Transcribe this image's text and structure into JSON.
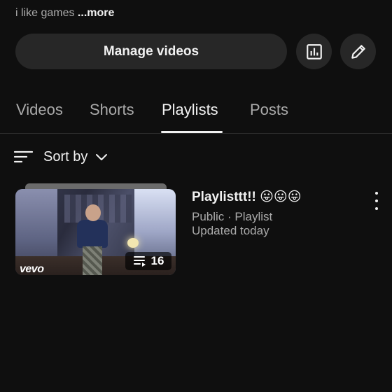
{
  "bio": {
    "text": "i like games ",
    "more": "...more"
  },
  "actions": {
    "manage_videos": "Manage videos",
    "analytics_icon": "bar-chart-icon",
    "edit_icon": "pencil-icon"
  },
  "tabs": [
    {
      "label": "Videos"
    },
    {
      "label": "Shorts"
    },
    {
      "label": "Playlists",
      "active": true
    },
    {
      "label": "Posts"
    }
  ],
  "sort": {
    "label": "Sort by",
    "icon": "sort-lines-icon"
  },
  "playlist": {
    "title": "Playlisttt!! 😛😛😛",
    "meta": "Public · Playlist",
    "updated": "Updated today",
    "count": "16",
    "badge": "vevo"
  },
  "colors": {
    "background": "#0f0f0f",
    "chip": "#272727",
    "text": "#f1f1f1",
    "muted": "#aaaaaa"
  }
}
